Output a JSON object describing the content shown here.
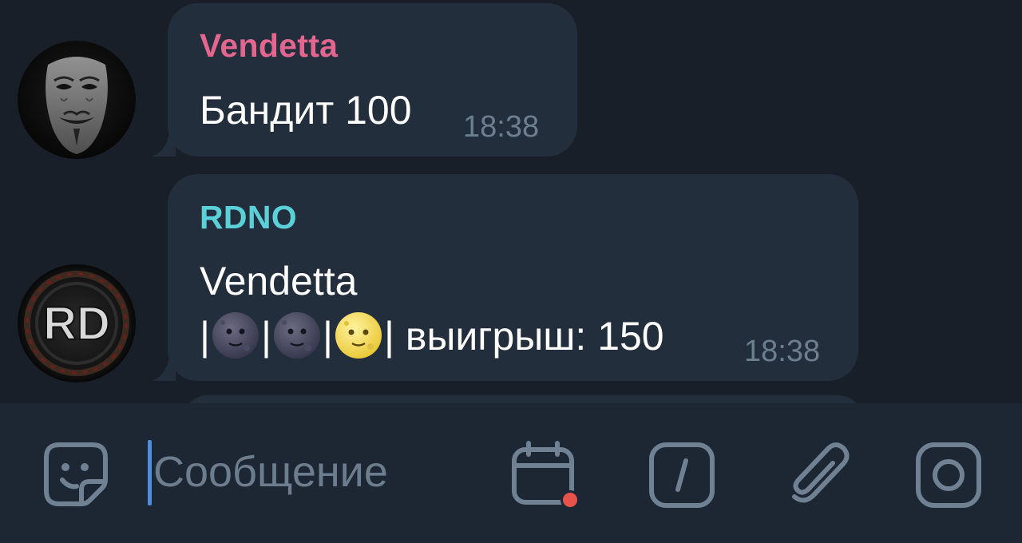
{
  "messages": [
    {
      "sender": "Vendetta",
      "sender_color": "#e2668e",
      "text": "Бандит 100",
      "time": "18:38",
      "avatar": "guy-fawkes-mask-avatar"
    },
    {
      "sender": "RDNO",
      "sender_color": "#5ad0d8",
      "line1": "Vendetta",
      "line2_suffix": "| выигрыш: 150",
      "slots": [
        "new-moon-face-emoji",
        "new-moon-face-emoji",
        "full-moon-face-emoji"
      ],
      "time": "18:38",
      "avatar": "rd-logo-avatar",
      "avatar_text": "RD"
    }
  ],
  "input": {
    "placeholder": "Сообщение",
    "icons": [
      "sticker-icon",
      "schedule-calendar-icon",
      "bot-command-icon",
      "paperclip-icon",
      "camera-icon"
    ],
    "accent": "#4f8fe0",
    "badge_color": "#e5534b"
  },
  "colors": {
    "background": "#181f29",
    "bubble": "#232e3c",
    "time": "#6d7f8f",
    "icon": "#6f8192"
  }
}
